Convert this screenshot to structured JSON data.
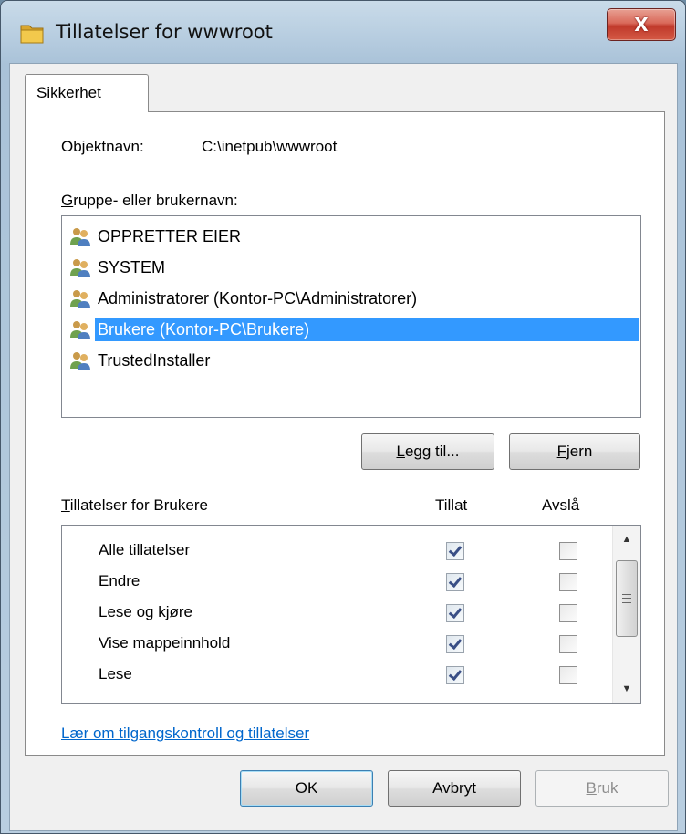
{
  "window": {
    "title": "Tillatelser for wwwroot",
    "close_label": "X"
  },
  "tab": {
    "label": "Sikkerhet"
  },
  "object": {
    "label": "Objektnavn:",
    "value": "C:\\inetpub\\wwwroot"
  },
  "groups": {
    "label_accel": "G",
    "label_rest": "ruppe- eller brukernavn:",
    "items": [
      {
        "label": "OPPRETTER EIER",
        "selected": false
      },
      {
        "label": "SYSTEM",
        "selected": false
      },
      {
        "label": "Administratorer (Kontor-PC\\Administratorer)",
        "selected": false
      },
      {
        "label": "Brukere (Kontor-PC\\Brukere)",
        "selected": true
      },
      {
        "label": "TrustedInstaller",
        "selected": false
      }
    ],
    "add_button_accel": "L",
    "add_button_rest": "egg til...",
    "remove_button_accel": "F",
    "remove_button_rest": "jern"
  },
  "permissions": {
    "label_accel": "T",
    "label_rest": "illatelser for Brukere",
    "allow_header": "Tillat",
    "deny_header": "Avslå",
    "rows": [
      {
        "name": "Alle tillatelser",
        "allow": true,
        "deny": false
      },
      {
        "name": "Endre",
        "allow": true,
        "deny": false
      },
      {
        "name": "Lese og kjøre",
        "allow": true,
        "deny": false
      },
      {
        "name": "Vise mappeinnhold",
        "allow": true,
        "deny": false
      },
      {
        "name": "Lese",
        "allow": true,
        "deny": false
      }
    ]
  },
  "help_link": "Lær om tilgangskontroll og tillatelser",
  "footer": {
    "ok_label": "OK",
    "cancel_label": "Avbryt",
    "apply_accel": "B",
    "apply_rest": "ruk"
  },
  "colors": {
    "selection": "#3399ff",
    "link": "#0066cc",
    "close_button": "#c0392b"
  }
}
